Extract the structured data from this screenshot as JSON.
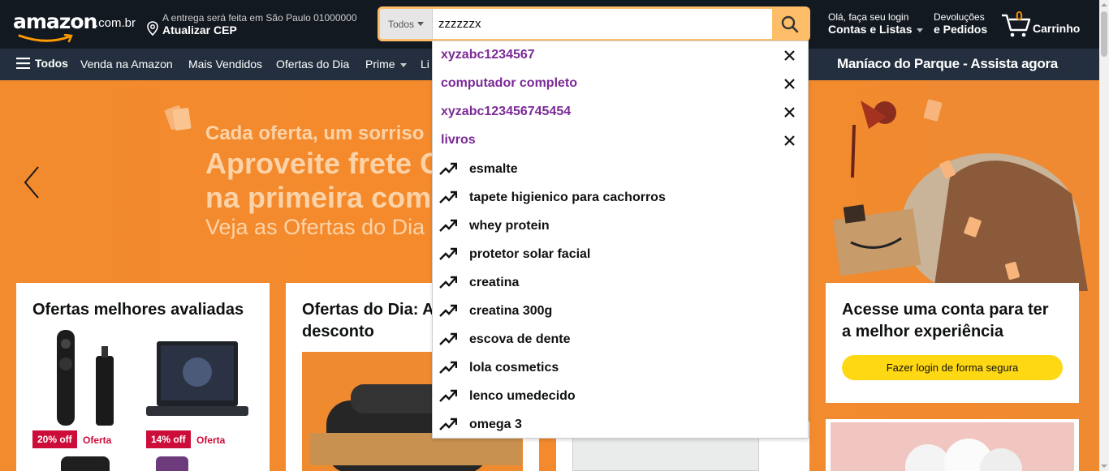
{
  "header": {
    "logo_text": "amazon",
    "logo_suffix": ".com.br",
    "deliver_line1": "A entrega será feita em São Paulo 01000000",
    "deliver_line2": "Atualizar CEP",
    "search_category": "Todos",
    "search_value": "zzzzzzx",
    "account_line1": "Olá, faça seu login",
    "account_line2": "Contas e Listas",
    "returns_line1": "Devoluções",
    "returns_line2": "e Pedidos",
    "cart_count": "0",
    "cart_label": "Carrinho"
  },
  "nav": {
    "all": "Todos",
    "items": [
      "Venda na Amazon",
      "Mais Vendidos",
      "Ofertas do Dia",
      "Prime",
      "Li"
    ],
    "promo": "Maníaco do Parque - Assista agora"
  },
  "hero": {
    "line1": "Cada oferta, um sorriso",
    "line2": "Aproveite frete G",
    "line3": "na primeira comp",
    "line4": "Veja as Ofertas do Dia"
  },
  "cards": {
    "card1_title": "Ofertas melhores avaliadas",
    "card1_deal1_badge": "20% off",
    "card1_deal1_label": "Oferta",
    "card1_deal2_badge": "14% off",
    "card1_deal2_label": "Oferta",
    "card2_title_l1": "Ofertas do Dia: A",
    "card2_title_l2": "desconto",
    "card4_title_l1": "Acesse uma conta para ter",
    "card4_title_l2": "a melhor experiência",
    "card4_button": "Fazer login de forma segura"
  },
  "suggestions": {
    "recent": [
      "xyzabc1234567",
      "computador completo",
      "xyzabc123456745454",
      "livros"
    ],
    "trending": [
      "esmalte",
      "tapete higienico para cachorros",
      "whey protein",
      "protetor solar facial",
      "creatina",
      "creatina 300g",
      "escova de dente",
      "lola cosmetics",
      "lenco umedecido",
      "omega 3"
    ]
  },
  "colors": {
    "header_bg": "#131921",
    "nav_bg": "#232f3e",
    "accent": "#febd69",
    "recent_text": "#7b2a96",
    "deal_red": "#cc0c39",
    "hero_orange": "#f28a2e"
  }
}
